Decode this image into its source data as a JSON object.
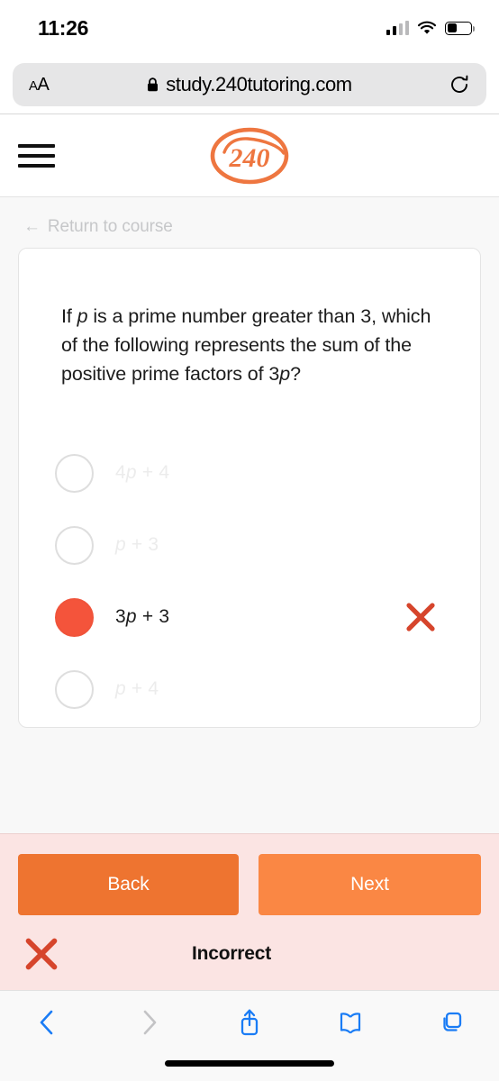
{
  "status_bar": {
    "time": "11:26",
    "signal_icon": "cellular-signal-icon",
    "wifi_icon": "wifi-icon",
    "battery_icon": "battery-icon",
    "battery_level_pct": 42
  },
  "browser": {
    "text_size_label_small": "A",
    "text_size_label_large": "A",
    "lock_icon": "lock-icon",
    "url": "study.240tutoring.com",
    "reload_icon": "reload-icon",
    "toolbar": {
      "back_icon": "chevron-left-icon",
      "forward_icon": "chevron-right-icon",
      "share_icon": "share-icon",
      "bookmarks_icon": "book-icon",
      "tabs_icon": "tabs-icon"
    }
  },
  "site_header": {
    "menu_icon": "hamburger-menu-icon",
    "logo_text": "240"
  },
  "page": {
    "return_link": {
      "arrow": "←",
      "label": "Return to course"
    },
    "question": {
      "line1": "If ",
      "var1": "p",
      "line1b": " is a prime number greater than 3,",
      "line2": "which of the following represents the sum",
      "line3a": "of the positive prime factors of 3",
      "var2": "p",
      "line3b": "?"
    },
    "options": [
      {
        "prefix": "4",
        "var": "p",
        "suffix": " + 4",
        "selected": false,
        "state": "disabled"
      },
      {
        "prefix": "",
        "var": "p",
        "suffix": " + 3",
        "selected": false,
        "state": "disabled"
      },
      {
        "prefix": "3",
        "var": "p",
        "suffix": " + 3",
        "selected": true,
        "state": "selected-incorrect",
        "mark_icon": "x-mark-icon"
      },
      {
        "prefix": "",
        "var": "p",
        "suffix": " + 4",
        "selected": false,
        "state": "disabled"
      }
    ]
  },
  "feedback": {
    "back_label": "Back",
    "next_label": "Next",
    "result_icon": "x-mark-icon",
    "result_text": "Incorrect"
  },
  "colors": {
    "brand_orange": "#ee7430",
    "next_orange": "#fa8744",
    "selected_red": "#f4543b",
    "x_mark_red": "#d6452c",
    "feedback_bg": "#fbe4e3",
    "page_bg": "#f8f8f8",
    "safari_blue": "#1a7cf5"
  }
}
